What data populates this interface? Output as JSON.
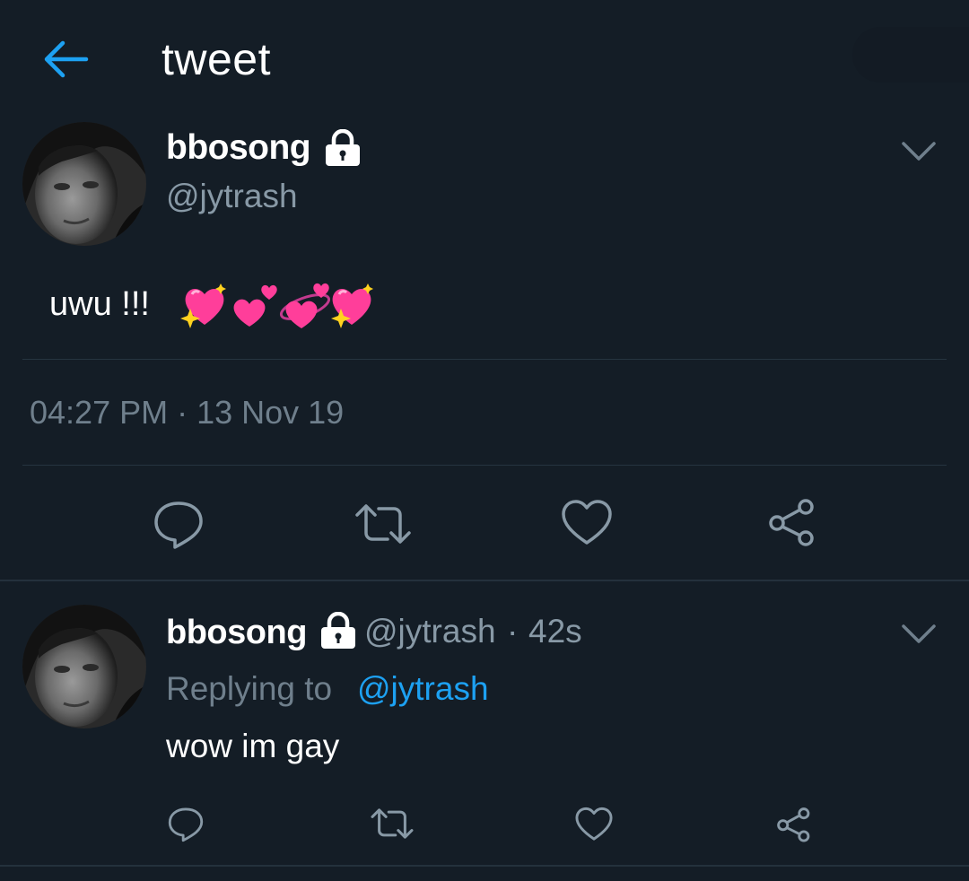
{
  "header": {
    "title": "tweet",
    "back_icon": "arrow-left-icon"
  },
  "tweet": {
    "display_name": "bbosong",
    "handle": "@jytrash",
    "text": "uwu !!!",
    "emojis": [
      "sparkling-heart",
      "two-hearts",
      "revolving-hearts",
      "sparkling-heart"
    ],
    "timestamp": "04:27 PM · 13 Nov 19",
    "actions": [
      "reply-icon",
      "retweet-icon",
      "like-icon",
      "share-icon"
    ]
  },
  "reply": {
    "display_name": "bbosong",
    "handle": "@jytrash",
    "separator": "·",
    "time": "42s",
    "replying_to_label": "Replying to",
    "replying_to_handle": "@jytrash",
    "text": "wow im gay",
    "actions": [
      "reply-icon",
      "retweet-icon",
      "like-icon",
      "share-icon"
    ]
  },
  "colors": {
    "background": "#141d26",
    "accent": "#1da1f2",
    "secondary_text": "#8899a6",
    "divider": "#263440",
    "heart_pink": "#ff3e9a"
  }
}
